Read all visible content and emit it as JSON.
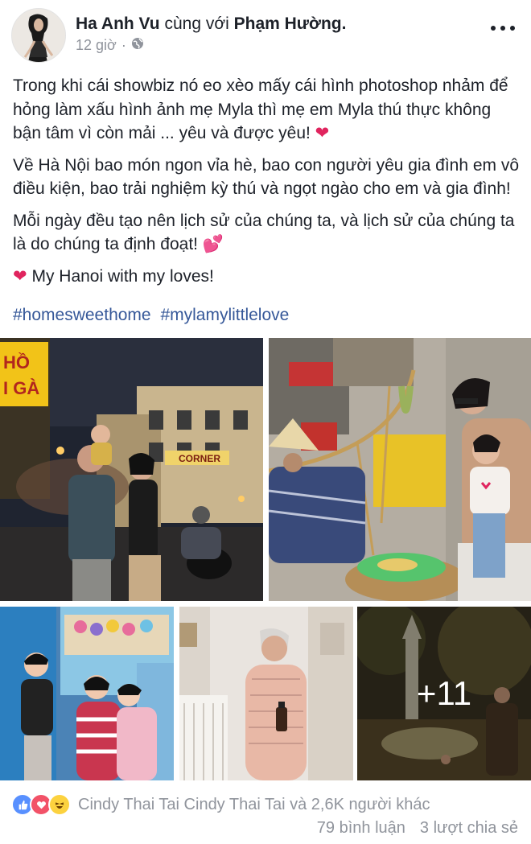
{
  "post": {
    "author": "Ha Anh Vu",
    "with_text": "cùng với",
    "tagged": "Phạm Hường.",
    "time": "12 giờ",
    "privacy_icon": "globe-icon",
    "paragraphs": [
      "Trong khi cái showbiz nó eo xèo mấy cái hình photoshop nhảm để hỏng làm xấu hình ảnh mẹ Myla thì mẹ em Myla thú thực không bận tâm vì còn mải ... yêu và được yêu!",
      "Về Hà Nội bao món ngon vỉa hè, bao con người yêu gia đình em vô điều kiện, bao trải nghiệm kỳ thú và ngọt ngào cho em và gia đình!",
      "Mỗi ngày đều tạo nên lịch sử của chúng ta, và lịch sử của chúng ta là do chúng ta định đoạt!",
      "My Hanoi with my loves!"
    ],
    "hashtags": [
      "#homesweethome",
      "#mylamylittlelove"
    ],
    "more_photos": "+11"
  },
  "photo_signs": {
    "shop_sign_left": "HỒ",
    "shop_sign_left2": "I GÀ",
    "corner_sign": "CORNER"
  },
  "footer": {
    "reactions": [
      "like-icon",
      "love-icon",
      "haha-icon"
    ],
    "reaction_text": "Cindy Thai Tai Cindy Thai Tai và 2,6K người khác",
    "comments": "79 bình luận",
    "shares": "3 lượt chia sẻ"
  },
  "colors": {
    "text": "#1d2129",
    "meta": "#90949c",
    "link": "#365899",
    "heart": "#e0245e"
  }
}
